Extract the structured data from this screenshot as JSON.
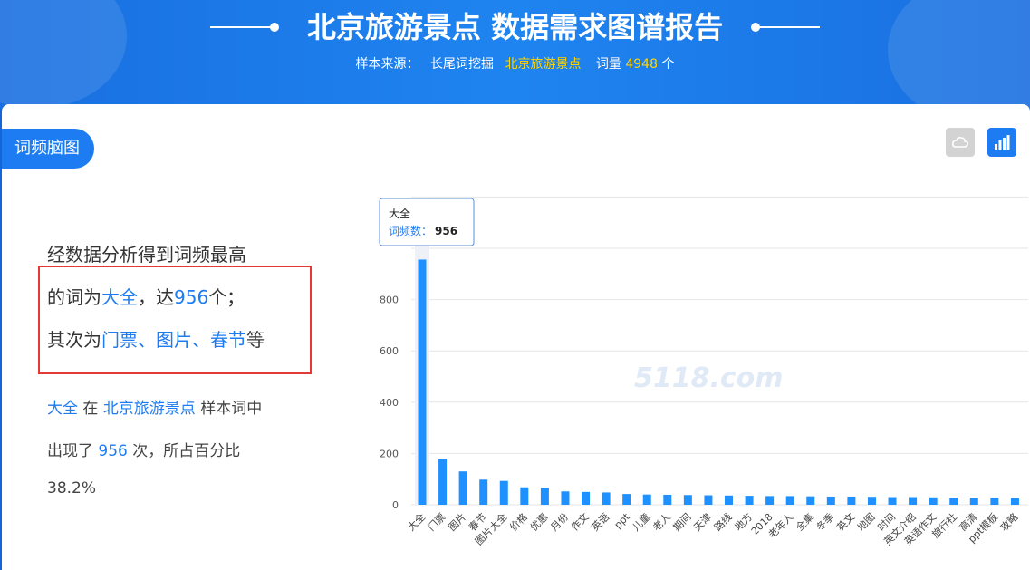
{
  "header": {
    "title": "北京旅游景点 数据需求图谱报告",
    "source_label": "样本来源：",
    "source_method": "长尾词挖掘",
    "source_keyword": "北京旅游景点",
    "count_label": "词量",
    "count_value": "4948",
    "count_unit": "个"
  },
  "panel": {
    "badge": "词频脑图",
    "cloud_button_icon": "cloud-icon",
    "bar_button_icon": "bar-chart-icon"
  },
  "analysis": {
    "line1": "经数据分析得到词频最高",
    "line2_prefix": "的词为",
    "top_word": "大全",
    "line2_mid": "，达",
    "top_value": "956",
    "line2_suffix": "个；",
    "line3_prefix": "其次为",
    "others": "门票、图片、春节",
    "line3_suffix": "等",
    "s1_word": "大全",
    "s1_in": "在",
    "s1_keyword": "北京旅游景点",
    "s1_suffix": "样本词中",
    "s2_prefix": "出现了",
    "s2_value": "956",
    "s2_suffix": "次，所占百分比",
    "s3_percent": "38.2%"
  },
  "tooltip": {
    "title": "大全",
    "series_label": "词频数：",
    "value": "956"
  },
  "watermark": "5118.com",
  "chart_data": {
    "type": "bar",
    "categories": [
      "大全",
      "门票",
      "图片",
      "春节",
      "图片大全",
      "价格",
      "优惠",
      "月份",
      "作文",
      "英语",
      "ppt",
      "儿童",
      "老人",
      "期间",
      "天津",
      "路线",
      "地方",
      "2018",
      "老年人",
      "全集",
      "冬季",
      "英文",
      "地图",
      "时间",
      "英文介绍",
      "英语作文",
      "旅行社",
      "高清",
      "ppt模板",
      "攻略"
    ],
    "series": [
      {
        "name": "词频数",
        "values": [
          956,
          180,
          130,
          98,
          93,
          68,
          66,
          52,
          50,
          48,
          42,
          40,
          39,
          38,
          37,
          36,
          35,
          34,
          34,
          33,
          32,
          32,
          31,
          30,
          30,
          29,
          28,
          28,
          27,
          26
        ]
      }
    ],
    "ylim": [
      0,
      1200
    ],
    "yticks": [
      0,
      200,
      400,
      600,
      800
    ],
    "grid": true,
    "bar_color": "#1e90ff",
    "highlight_index": 0
  }
}
